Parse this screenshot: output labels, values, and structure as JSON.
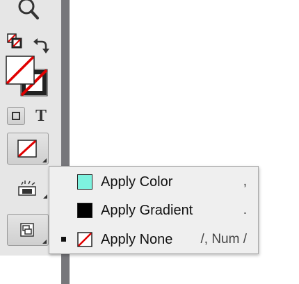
{
  "toolbar": {
    "type_tool_label": "T"
  },
  "menu": {
    "items": [
      {
        "label": "Apply Color",
        "shortcut": ",",
        "swatch_color": "#7ef2df",
        "selected": false
      },
      {
        "label": "Apply Gradient",
        "shortcut": ".",
        "swatch_color": "#000000",
        "selected": false
      },
      {
        "label": "Apply None",
        "shortcut": "/, Num /",
        "swatch_color": "none",
        "selected": true
      }
    ]
  },
  "colors": {
    "panel_bg": "#e6e6e6",
    "none_red": "#e00000",
    "menu_bg": "#efefef"
  }
}
